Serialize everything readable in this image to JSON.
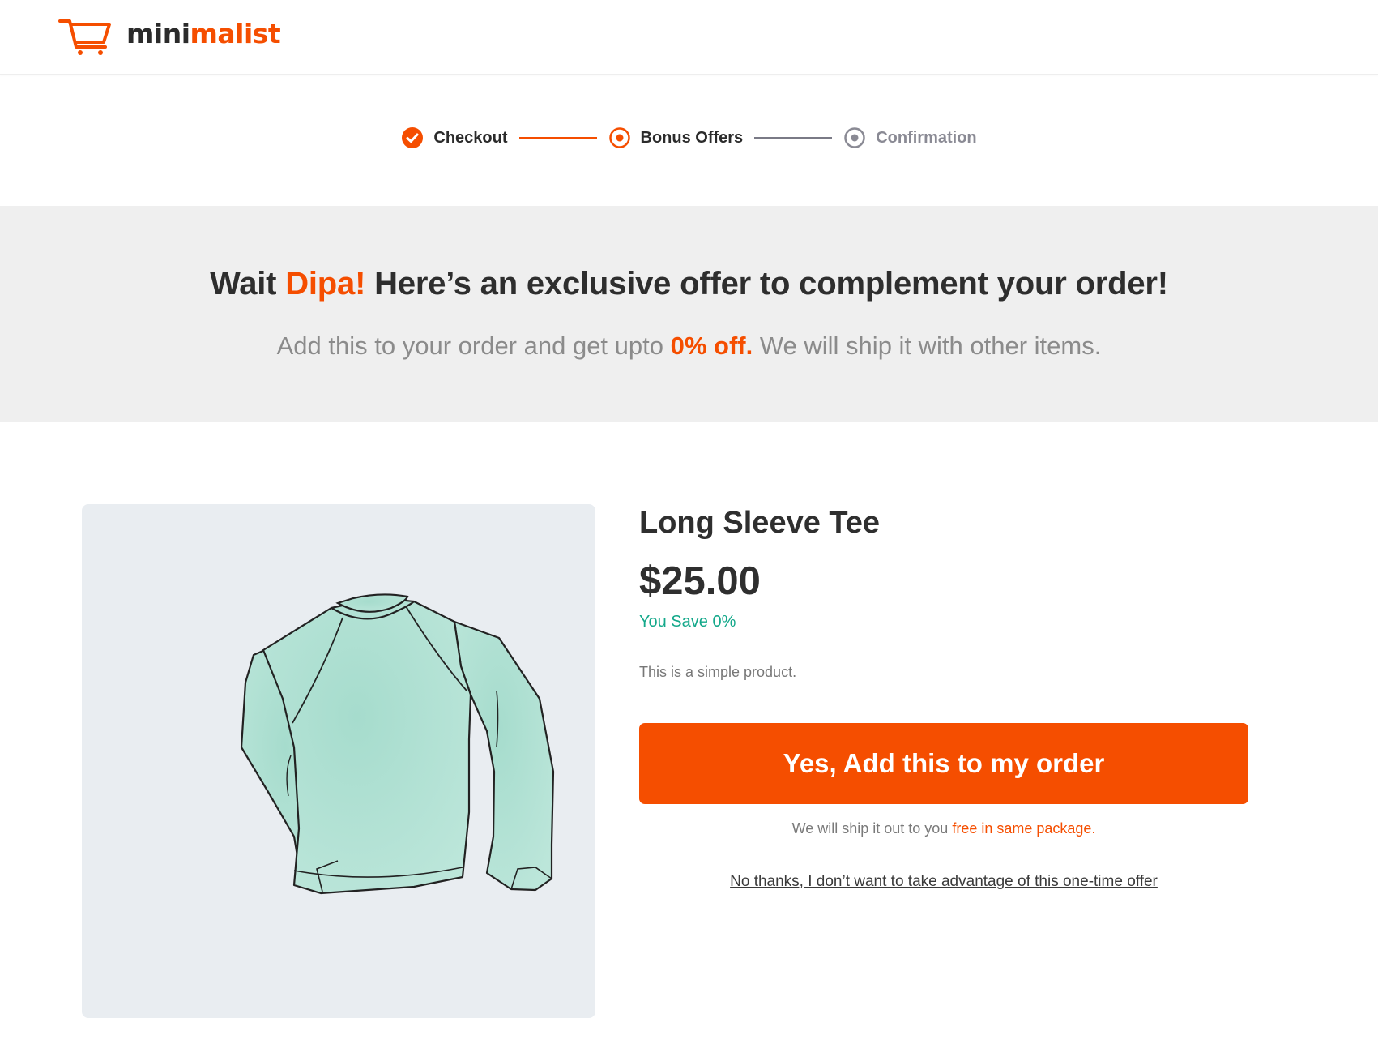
{
  "brand": {
    "name_part1": "mini",
    "name_part2": "malist",
    "accent_color": "#f54e00"
  },
  "steps": [
    {
      "label": "Checkout",
      "state": "completed",
      "icon": "check-circle-icon"
    },
    {
      "label": "Bonus Offers",
      "state": "current",
      "icon": "radio-dot-icon"
    },
    {
      "label": "Confirmation",
      "state": "upcoming",
      "icon": "radio-dot-icon"
    }
  ],
  "banner": {
    "title_prefix": "Wait ",
    "customer_name": "Dipa!",
    "title_suffix": " Here’s an exclusive offer to complement your order!",
    "subtitle_prefix": "Add this to your order and get upto ",
    "discount": "0% off.",
    "subtitle_suffix": " We will ship it with other items."
  },
  "product": {
    "title": "Long Sleeve Tee",
    "price": "$25.00",
    "savings": "You Save 0%",
    "description": "This is a simple product.",
    "image_icon": "long-sleeve-tee-illustration"
  },
  "actions": {
    "accept_label": "Yes, Add this to my order",
    "ship_note_prefix": "We will ship it out to you ",
    "ship_note_highlight": "free in same package.",
    "decline_label": "No thanks, I don’t want to take advantage of this one-time offer"
  },
  "colors": {
    "accent": "#f54e00",
    "savings_green": "#13a88a",
    "banner_bg": "#efefef",
    "image_bg": "#e9edf1",
    "shirt_fill": "#b5e2d6"
  }
}
